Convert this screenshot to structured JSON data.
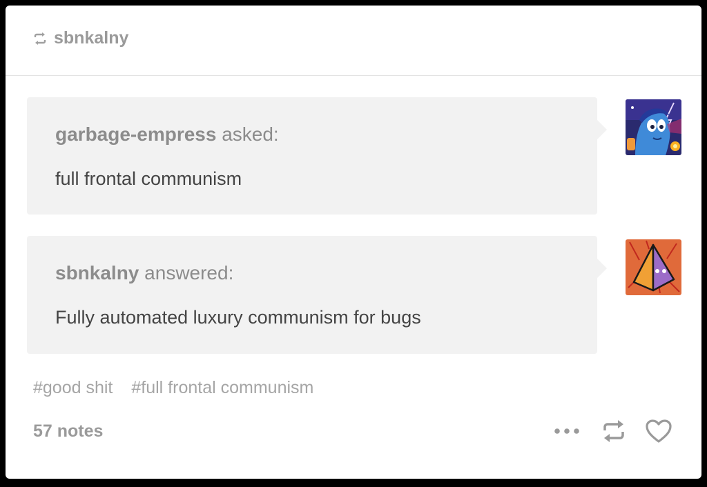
{
  "post": {
    "reblogged_from": "sbnkalny",
    "ask": {
      "username": "garbage-empress",
      "verb": "asked:",
      "text": "full frontal communism",
      "avatar_icon": "blue-character-avatar-icon"
    },
    "answer": {
      "username": "sbnkalny",
      "verb": "answered:",
      "text": "Fully automated luxury communism for bugs",
      "avatar_icon": "pyramid-avatar-icon"
    },
    "tags": [
      "#good shit",
      "#full frontal communism"
    ],
    "notes": "57 notes",
    "actions": {
      "more_icon": "more-dots-icon",
      "reblog_icon": "reblog-icon",
      "like_icon": "heart-icon"
    }
  },
  "colors": {
    "bubble": "#f2f2f2",
    "muted_text": "#9a9a9a",
    "body_text": "#444444",
    "avatar_answer_bg": "#e06a3a"
  }
}
